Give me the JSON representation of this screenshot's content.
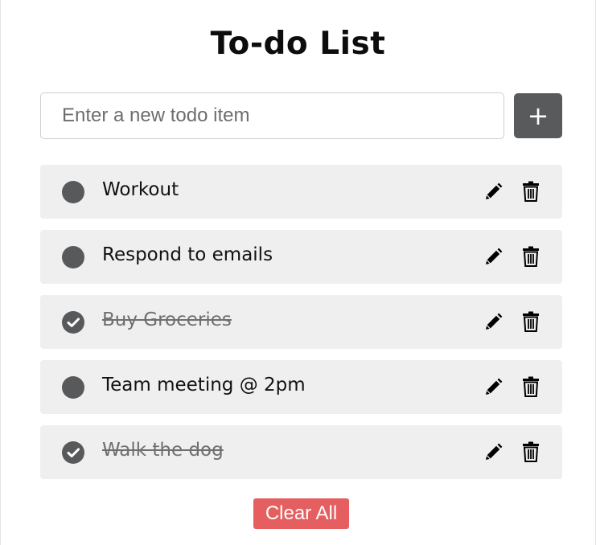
{
  "title": "To-do List",
  "input": {
    "placeholder": "Enter a new todo item",
    "value": ""
  },
  "add_button": {
    "label": "+"
  },
  "todos": [
    {
      "label": "Workout",
      "completed": false
    },
    {
      "label": "Respond to emails",
      "completed": false
    },
    {
      "label": "Buy Groceries",
      "completed": true
    },
    {
      "label": "Team meeting @ 2pm",
      "completed": false
    },
    {
      "label": "Walk the dog",
      "completed": true
    }
  ],
  "icons": {
    "check": "circle-check-icon",
    "edit": "pencil-icon",
    "delete": "trash-icon"
  },
  "clear_button": {
    "label": "Clear All"
  },
  "colors": {
    "add_button": "#585a5c",
    "item_background": "#efefef",
    "status_circle": "#58595b",
    "clear_button": "#e55f60"
  }
}
